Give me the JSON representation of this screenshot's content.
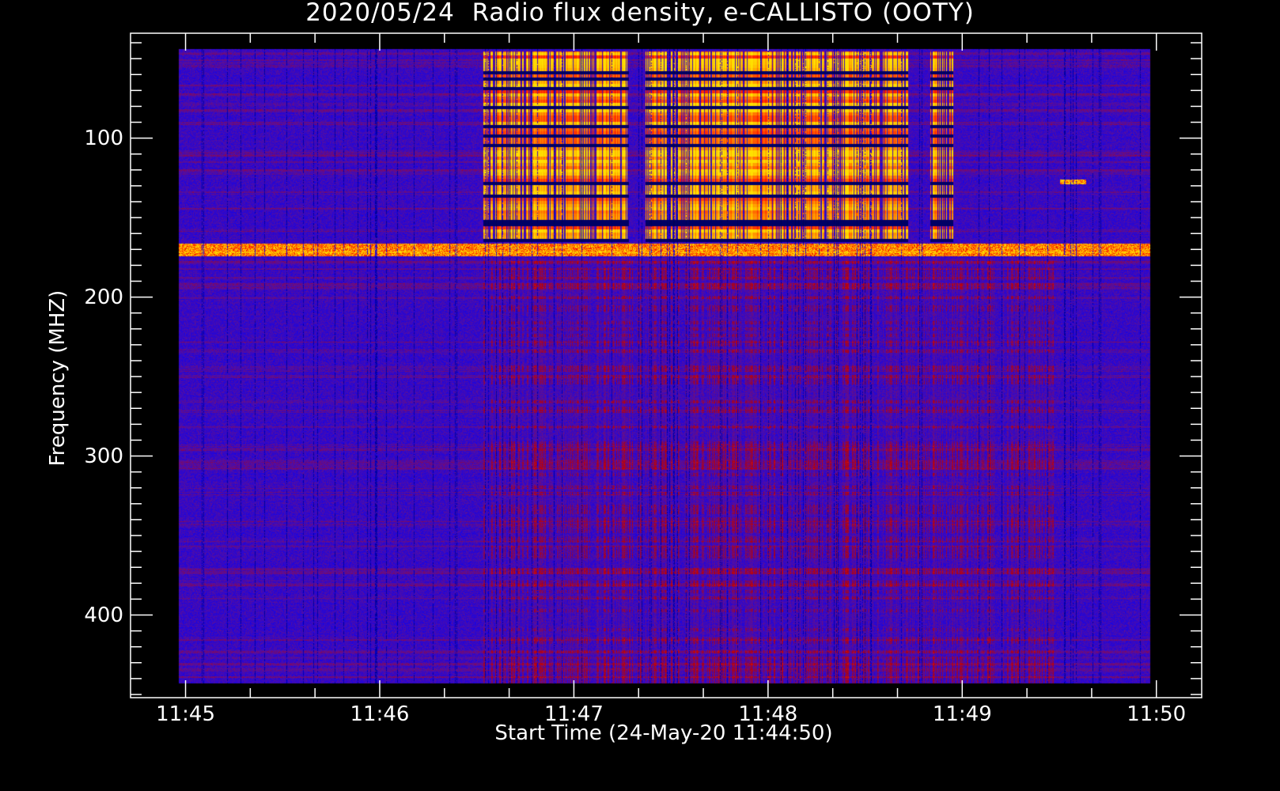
{
  "chart_data": {
    "type": "heatmap",
    "title": "2020/05/24  Radio flux density, e-CALLISTO (OOTY)",
    "xlabel": "Start Time (24-May-20 11:44:50)",
    "ylabel": "Frequency (MHZ)",
    "x_tick_labels": [
      "11:45",
      "11:46",
      "11:47",
      "11:48",
      "11:49",
      "11:50"
    ],
    "x_ticks_seconds_from_1145": [
      0,
      60,
      120,
      180,
      240,
      300
    ],
    "x_minor_tick_interval_s": 20,
    "y_tick_labels": [
      "100",
      "200",
      "300",
      "400"
    ],
    "y_ticks_mhz": [
      100,
      200,
      300,
      400
    ],
    "y_minor_tick_interval_mhz": 10,
    "xlim_seconds_from_1145": [
      -17,
      314
    ],
    "ylim_mhz": [
      34,
      452
    ],
    "y_inverted": true,
    "data_time_range_s": [
      -2,
      298
    ],
    "data_freq_range_mhz": [
      44,
      443
    ],
    "colormap": [
      "#000050",
      "#0000ff",
      "#5a0f9a",
      "#b00010",
      "#ff1a00",
      "#ff8a00",
      "#ffe000"
    ],
    "features": [
      {
        "name": "intense broadband emission/RFI",
        "t_start_s": 92,
        "t_end_s": 223,
        "f_low_mhz": 45,
        "f_high_mhz": 165,
        "intensity": 0.85,
        "gaps_s": [
          [
            137,
            142
          ]
        ]
      },
      {
        "name": "secondary burst",
        "t_start_s": 230,
        "t_end_s": 237,
        "f_low_mhz": 45,
        "f_high_mhz": 165,
        "intensity": 0.8
      },
      {
        "name": "persistent interference band",
        "t_start_s": -2,
        "t_end_s": 298,
        "f_low_mhz": 166,
        "f_high_mhz": 174,
        "intensity": 0.7
      },
      {
        "name": "weak enhancement lower band",
        "t_start_s": 92,
        "t_end_s": 268,
        "f_low_mhz": 175,
        "f_high_mhz": 443,
        "intensity": 0.3
      },
      {
        "name": "narrow-band blip",
        "t_start_s": 270,
        "t_end_s": 278,
        "f_low_mhz": 126,
        "f_high_mhz": 129,
        "intensity": 0.8
      }
    ],
    "grid": false
  }
}
